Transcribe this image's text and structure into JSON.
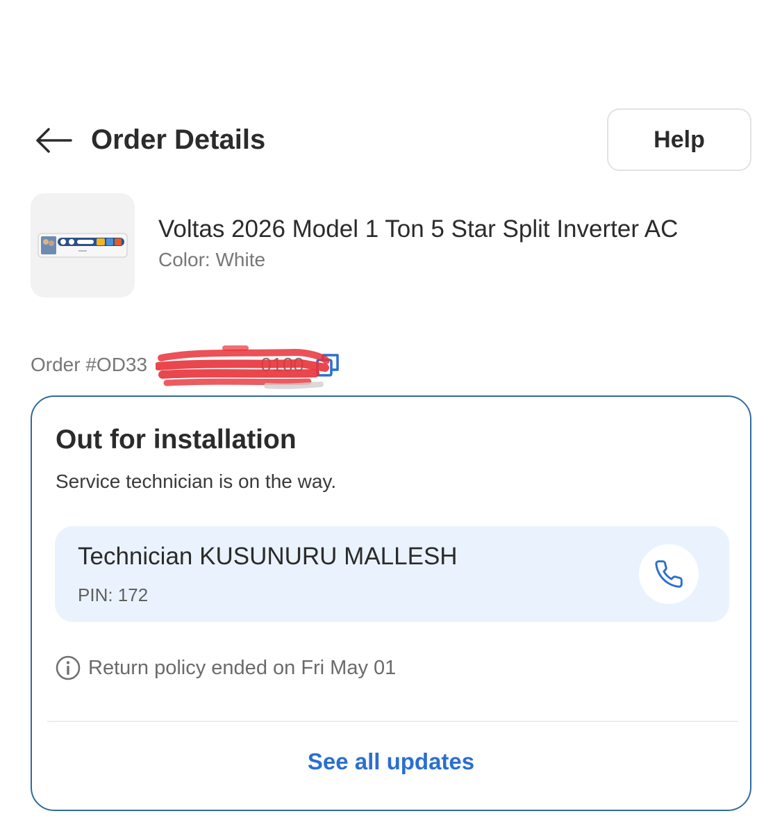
{
  "header": {
    "title": "Order Details",
    "help_label": "Help",
    "back_icon": "arrow-left-icon"
  },
  "product": {
    "name": "Voltas 2026 Model 1 Ton 5 Star Split Inverter AC",
    "color": "Color: White"
  },
  "order": {
    "id_text": "Order #OD33                     0100",
    "copy_icon": "copy-icon",
    "redaction_color": "#e8323a"
  },
  "status_card": {
    "title": "Out for installation",
    "subtitle": "Service technician is on the way.",
    "technician": {
      "name": "Technician KUSUNURU MALLESH",
      "pin": "PIN: 172",
      "call_icon": "phone-icon"
    },
    "return_policy": "Return policy ended on Fri May 01",
    "see_all_label": "See all updates"
  },
  "colors": {
    "accent": "#2a6fd0",
    "card_border": "#2f6a9b",
    "tech_bg": "#eaf3fd"
  }
}
